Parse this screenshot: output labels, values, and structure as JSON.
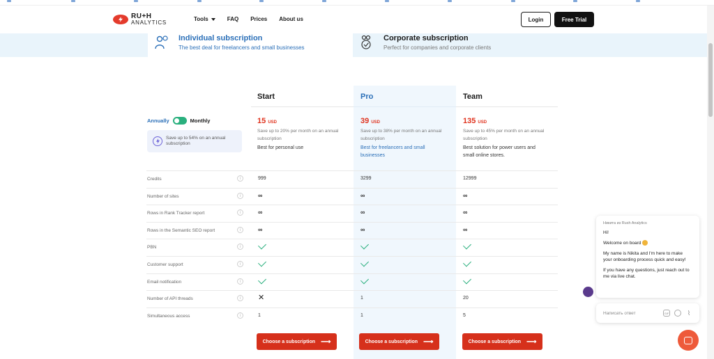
{
  "brand": {
    "line1": "RU+H",
    "line2": "ANALYTICS",
    "accent_color": "#e43b2c"
  },
  "nav": {
    "tools": "Tools",
    "faq": "FAQ",
    "prices": "Prices",
    "about": "About us"
  },
  "header_actions": {
    "login": "Login",
    "trial": "Free Trial"
  },
  "subscription_types": [
    {
      "title": "Individual subscription",
      "desc": "The best deal for freelancers and small businesses",
      "icon": "person-icon"
    },
    {
      "title": "Corporate subscription",
      "desc": "Perfect for companies and corporate clients",
      "icon": "team-check-icon"
    }
  ],
  "billing": {
    "annually": "Annually",
    "monthly": "Monthly",
    "save_text": "Save up to 54% on an annual subscription"
  },
  "plans": [
    {
      "name": "Start",
      "price": "15",
      "currency": "USD",
      "note": "Save up to 20% per month on an annual subscription",
      "best": "Best for personal use"
    },
    {
      "name": "Pro",
      "price": "39",
      "currency": "USD",
      "note": "Save up to 38% per month on an annual subscription",
      "best": "Best for freelancers and small businesses"
    },
    {
      "name": "Team",
      "price": "135",
      "currency": "USD",
      "note": "Save up to 45% per month on an annual subscription",
      "best": "Best solution for power users and small online stores."
    }
  ],
  "features": [
    {
      "label": "Credits",
      "values": [
        "999",
        "3299",
        "12999"
      ]
    },
    {
      "label": "Number of sites",
      "values": [
        "∞",
        "∞",
        "∞"
      ]
    },
    {
      "label": "Rows in Rank Tracker report",
      "values": [
        "∞",
        "∞",
        "∞"
      ]
    },
    {
      "label": "Rows in the Semantic SEO report",
      "values": [
        "∞",
        "∞",
        "∞"
      ]
    },
    {
      "label": "PBN",
      "values": [
        "check",
        "check",
        "check"
      ]
    },
    {
      "label": "Customer support",
      "values": [
        "check",
        "check",
        "check"
      ]
    },
    {
      "label": "Email notification",
      "values": [
        "check",
        "check",
        "check"
      ]
    },
    {
      "label": "Number of API threads",
      "values": [
        "cross",
        "1",
        "20"
      ]
    },
    {
      "label": "Simultaneous access",
      "values": [
        "1",
        "1",
        "5"
      ]
    }
  ],
  "choose_label": "Choose a subscription",
  "chat": {
    "from": "Никита из Rush Analytics",
    "messages": [
      "Hi!",
      "Welcome on board",
      "My name is Nikita and I'm here to make your onboarding process quick and easy!",
      "If you have any questions, just reach out to me via live chat."
    ],
    "input_placeholder": "Написать ответ",
    "gif_label": "GIF"
  }
}
